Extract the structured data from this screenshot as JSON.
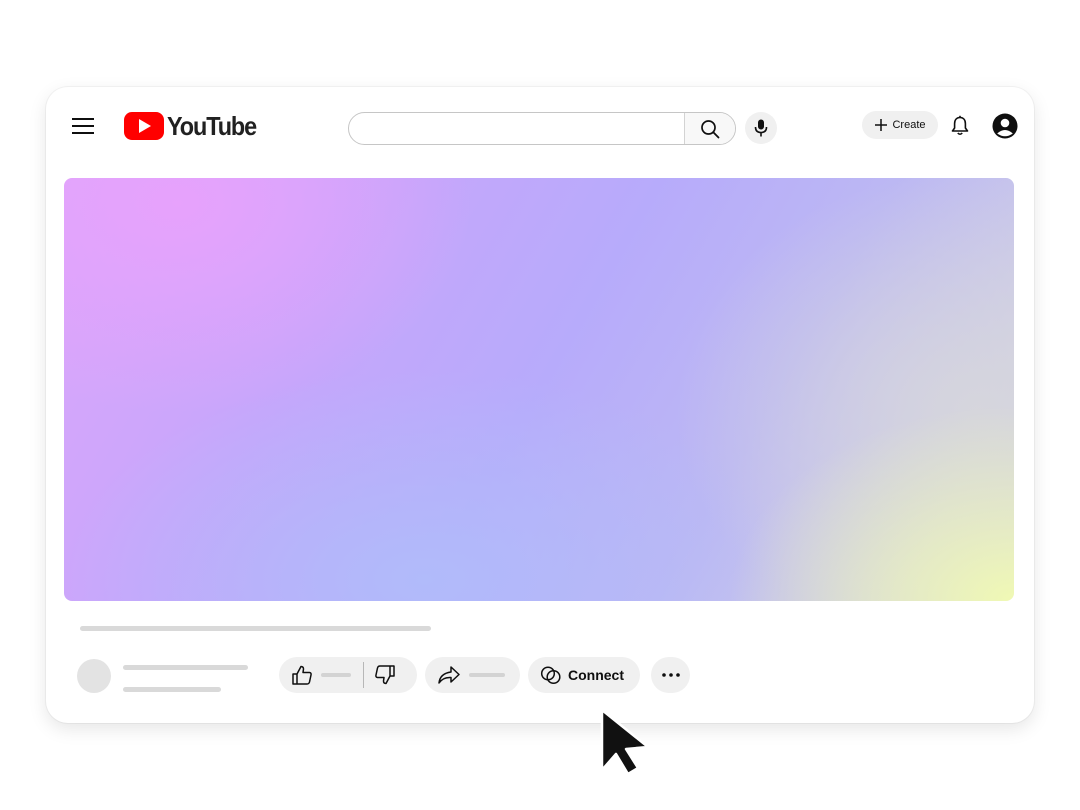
{
  "header": {
    "logo_text": "YouTube",
    "search_placeholder": "",
    "create_label": "Create"
  },
  "actions": {
    "connect_label": "Connect"
  },
  "colors": {
    "brand_red": "#ff0000",
    "pill_background": "#f0f0f0",
    "skeleton": "#d9d9d9"
  },
  "icons": {
    "menu": "hamburger-menu-icon",
    "search": "search-icon",
    "mic": "microphone-icon",
    "create": "plus-icon",
    "notifications": "bell-icon",
    "account": "account-circle-icon",
    "like": "thumbs-up-icon",
    "dislike": "thumbs-down-icon",
    "share": "share-arrow-icon",
    "connect": "connect-circles-icon",
    "more": "more-horizontal-icon",
    "pointer": "mouse-pointer-icon"
  }
}
